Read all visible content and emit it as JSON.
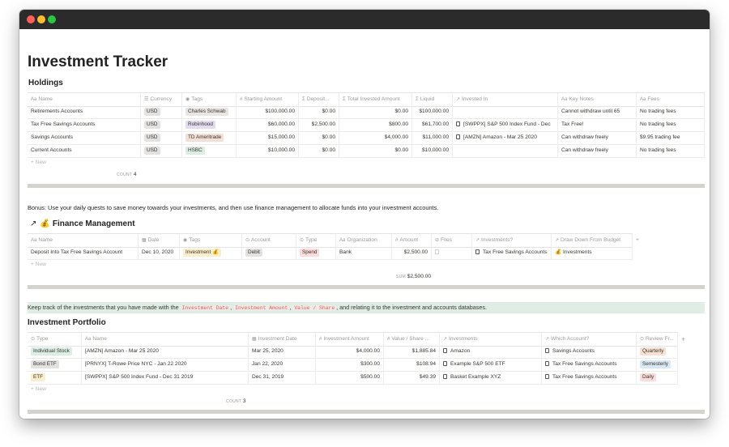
{
  "colors": {
    "titlebar": "#2b2b2b",
    "close": "#ff5f57",
    "minimize": "#febc2e",
    "maximize": "#28c840",
    "callout_bg": "#dfede4",
    "code_text": "#e05d55"
  },
  "page": {
    "title": "Investment Tracker"
  },
  "holdings": {
    "title": "Holdings",
    "columns": [
      "Name",
      "Currency",
      "Tags",
      "Starting Amount",
      "Deposit...",
      "Total Invested Amount",
      "Liquid",
      "Invested In",
      "Key Notes",
      "Fees"
    ],
    "column_icons": [
      "text-icon",
      "list-icon",
      "multi-select-icon",
      "number-icon",
      "formula-icon",
      "formula-icon",
      "sigma-icon",
      "relation-icon",
      "text-icon",
      "text-icon"
    ],
    "rows": [
      {
        "name": "Retirements Accounts",
        "currency": "USD",
        "tag": "Charles Schwab",
        "tag_color": "#e9e5e3",
        "starting": "$100,000.00",
        "deposit": "$0.00",
        "total": "$0.00",
        "liquid": "$100,000.00",
        "invested_in": "",
        "notes": "Cannot withdraw until 65",
        "fees": "No trading fees"
      },
      {
        "name": "Tax Free Savings Accounts",
        "currency": "USD",
        "tag": "Robinhood",
        "tag_color": "#e3dcf1",
        "starting": "$60,000.00",
        "deposit": "$2,500.00",
        "total": "$800.00",
        "liquid": "$61,700.00",
        "invested_in": "[SWPPX] S&P 500 Index Fund - Dec",
        "notes": "Tax Free!",
        "fees": "No trading fees"
      },
      {
        "name": "Savings Accounts",
        "currency": "USD",
        "tag": "TD Ameritrade",
        "tag_color": "#f4dfd6",
        "starting": "$15,000.00",
        "deposit": "$0.00",
        "total": "$4,000.00",
        "liquid": "$11,000.00",
        "invested_in": "[AMZN] Amazon - Mar 25 2020",
        "notes": "Can withdraw freely",
        "fees": "$9.95 trading fee"
      },
      {
        "name": "Current Accounts",
        "currency": "USD",
        "tag": "HSBC",
        "tag_color": "#dbeee4",
        "starting": "$10,000.00",
        "deposit": "$0.00",
        "total": "$0.00",
        "liquid": "$10,000.00",
        "invested_in": "",
        "notes": "Can withdraw freely",
        "fees": "No trading fees"
      }
    ],
    "new_label": "+ New",
    "count_label": "COUNT",
    "count_value": "4"
  },
  "bonus_text": "Bonus: Use your daily quests to save money towards your investments, and then use finance management to allocate funds into your investment accounts.",
  "finance": {
    "arrow": "↗",
    "emoji": "💰",
    "title": "Finance Management",
    "columns": [
      "Name",
      "Date",
      "Tags",
      "Account",
      "Type",
      "Organization",
      "Amount",
      "Files",
      "Investments?",
      "Draw Down From Budget"
    ],
    "column_icons": [
      "text-icon",
      "calendar-icon",
      "multi-select-icon",
      "select-icon",
      "select-icon",
      "text-icon",
      "number-icon",
      "attachment-icon",
      "relation-icon",
      "relation-icon"
    ],
    "rows": [
      {
        "name": "Deposit Into Tax Free Savings Account",
        "date": "Dec 10, 2020",
        "tag": "Investment 💰",
        "tag_color": "#fbeecc",
        "account": "Debit",
        "account_color": "#e3e2e0",
        "type": "Spend",
        "type_color": "#fbdcdc",
        "organization": "Bank",
        "amount": "$2,500.00",
        "files": "",
        "investments": "Tax Free Savings Accounts",
        "drawdown": "💰 Investments"
      }
    ],
    "new_label": "+ New",
    "sum_label": "SUM",
    "sum_value": "$2,500.00"
  },
  "callout": {
    "prefix": "Keep track of the investments that you have made with the ",
    "code1": "Investment Date",
    "sep1": ", ",
    "code2": "Investment Amount",
    "sep2": ", ",
    "code3": "Value / Share",
    "suffix": ", and relating it to the investment and accounts databases."
  },
  "portfolio": {
    "title": "Investment Portfolio",
    "columns": [
      "Type",
      "Name",
      "Investment Date",
      "Investment Amount",
      "Value / Share ...",
      "Investments",
      "Which Account?",
      "Review Fr..."
    ],
    "column_icons": [
      "select-icon",
      "text-icon",
      "calendar-icon",
      "number-icon",
      "number-icon",
      "relation-icon",
      "relation-icon",
      "select-icon"
    ],
    "rows": [
      {
        "type": "Individual Stock",
        "type_color": "#dbeee4",
        "name": "[AMZN] Amazon - Mar 25 2020",
        "date": "Mar 25, 2020",
        "amount": "$4,000.00",
        "value": "$1,885.84",
        "investment": "Amazon",
        "account": "Savings Accounts",
        "review": "Quarterly",
        "review_color": "#f8e1d2"
      },
      {
        "type": "Bond ETF",
        "type_color": "#e3e2e0",
        "name": "[PRNYX] T-Rowe Price NYC - Jan 22 2020",
        "date": "Jan 22, 2020",
        "amount": "$300.00",
        "value": "$108.94",
        "investment": "Example S&P 500 ETF",
        "account": "Tax Free Savings Accounts",
        "review": "Semesterly",
        "review_color": "#d8e8f4"
      },
      {
        "type": "ETF",
        "type_color": "#fbeecc",
        "name": "[SWPPX] S&P 500 Index Fund - Dec 31 2019",
        "date": "Dec 31, 2019",
        "amount": "$500.00",
        "value": "$49.39",
        "investment": "Basket Example XYZ",
        "account": "Tax Free Savings Accounts",
        "review": "Daily",
        "review_color": "#fbdcdc"
      }
    ],
    "new_label": "+ New",
    "count_label": "COUNT",
    "count_value": "3",
    "add_column": "+"
  }
}
